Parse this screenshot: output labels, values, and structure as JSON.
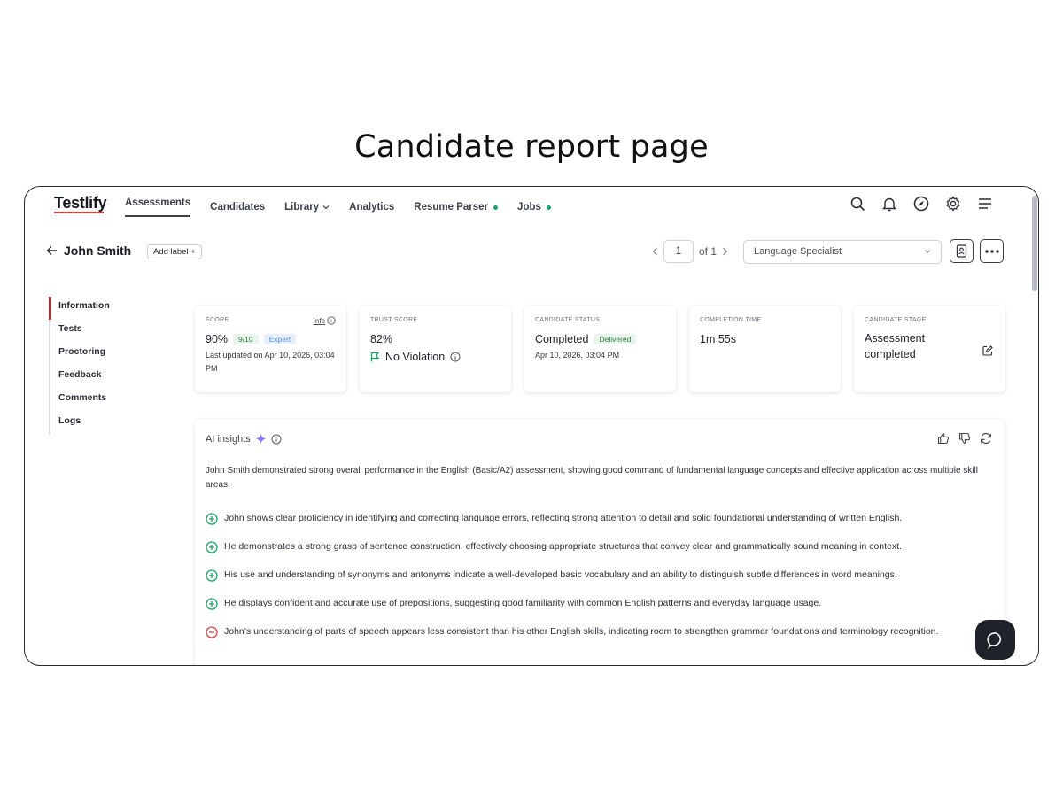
{
  "page_heading": "Candidate report page",
  "nav": {
    "logo": "Testlify",
    "links": [
      {
        "label": "Assessments"
      },
      {
        "label": "Candidates"
      },
      {
        "label": "Library"
      },
      {
        "label": "Analytics"
      },
      {
        "label": "Resume Parser"
      },
      {
        "label": "Jobs"
      }
    ],
    "icons": [
      "search-icon",
      "bell-icon",
      "compass-icon",
      "gear-icon",
      "menu-icon"
    ]
  },
  "header": {
    "candidate_name": "John Smith",
    "add_label": "Add label +",
    "page_current": "1",
    "page_of": "of 1",
    "role": "Language Specialist"
  },
  "sidebar": {
    "items": [
      "Information",
      "Tests",
      "Proctoring",
      "Feedback",
      "Comments",
      "Logs"
    ],
    "active": "Information"
  },
  "cards": {
    "score": {
      "title": "SCORE",
      "info": "Info",
      "value": "90%",
      "rating": "9/10",
      "level": "Expert",
      "updated": "Last updated on Apr 10, 2026, 03:04 PM"
    },
    "trust": {
      "title": "TRUST SCORE",
      "value": "82%",
      "violation": "No Violation"
    },
    "status": {
      "title": "CANDIDATE STATUS",
      "value": "Completed",
      "badge": "Delivered",
      "date": "Apr 10, 2026, 03:04 PM"
    },
    "completion": {
      "title": "COMPLETION TIME",
      "value": "1m 55s"
    },
    "stage": {
      "title": "CANDIDATE STAGE",
      "value": "Assessment completed"
    }
  },
  "ai_insights": {
    "title": "AI insights",
    "summary": "John Smith demonstrated strong overall performance in the English (Basic/A2) assessment, showing good command of fundamental language concepts and effective application across multiple skill areas.",
    "items": [
      {
        "type": "positive",
        "text": "John shows clear proficiency in identifying and correcting language errors, reflecting strong attention to detail and solid foundational understanding of written English."
      },
      {
        "type": "positive",
        "text": "He demonstrates a strong grasp of sentence construction, effectively choosing appropriate structures that convey clear and grammatically sound meaning in context."
      },
      {
        "type": "positive",
        "text": "His use and understanding of synonyms and antonyms indicate a well-developed basic vocabulary and an ability to distinguish subtle differences in word meanings."
      },
      {
        "type": "positive",
        "text": "He displays confident and accurate use of prepositions, suggesting good familiarity with common English patterns and everyday language usage."
      },
      {
        "type": "negative",
        "text": "John’s understanding of parts of speech appears less consistent than his other English skills, indicating room to strengthen grammar foundations and terminology recognition."
      }
    ]
  },
  "colors": {
    "accent_red": "#b32a2a",
    "positive": "#19a463",
    "negative": "#d9433f",
    "sparkle": "#8b7cf6"
  }
}
